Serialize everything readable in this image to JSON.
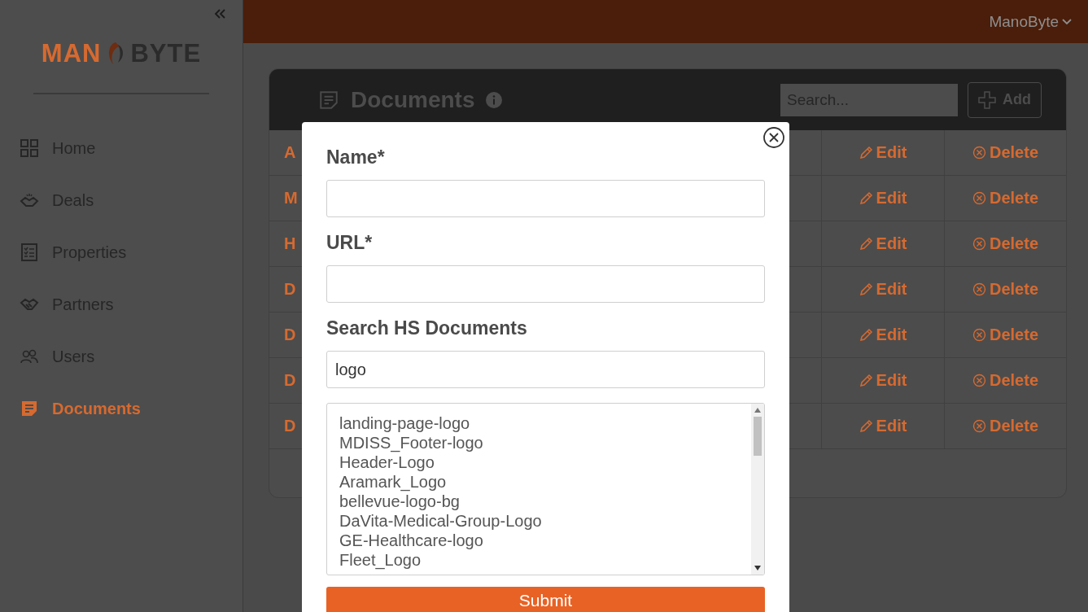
{
  "sidebar": {
    "logo": {
      "left": "MAN",
      "right": "BYTE"
    },
    "items": [
      {
        "label": "Home",
        "selected": false
      },
      {
        "label": "Deals",
        "selected": false
      },
      {
        "label": "Properties",
        "selected": false
      },
      {
        "label": "Partners",
        "selected": false
      },
      {
        "label": "Users",
        "selected": false
      },
      {
        "label": "Documents",
        "selected": true
      }
    ]
  },
  "header": {
    "user_menu": "ManoByte"
  },
  "documents": {
    "title": "Documents",
    "search": {
      "placeholder": "Search..."
    },
    "add_button": "Add",
    "rows": [
      {
        "name": "A",
        "edit": "Edit",
        "delete": "Delete"
      },
      {
        "name": "M",
        "edit": "Edit",
        "delete": "Delete"
      },
      {
        "name": "H",
        "edit": "Edit",
        "delete": "Delete"
      },
      {
        "name": "D",
        "edit": "Edit",
        "delete": "Delete"
      },
      {
        "name": "D",
        "edit": "Edit",
        "delete": "Delete"
      },
      {
        "name": "D",
        "edit": "Edit",
        "delete": "Delete"
      },
      {
        "name": "D",
        "edit": "Edit",
        "delete": "Delete"
      }
    ]
  },
  "modal": {
    "fields": [
      {
        "label": "Name*"
      },
      {
        "label": "URL*"
      },
      {
        "label": "Search HS Documents",
        "value": "logo"
      }
    ],
    "results": [
      "landing-page-logo",
      "MDISS_Footer-logo",
      "Header-Logo",
      "Aramark_Logo",
      "bellevue-logo-bg",
      "DaVita-Medical-Group-Logo",
      "GE-Healthcare-logo",
      "Fleet_Logo"
    ],
    "submit": "Submit"
  }
}
